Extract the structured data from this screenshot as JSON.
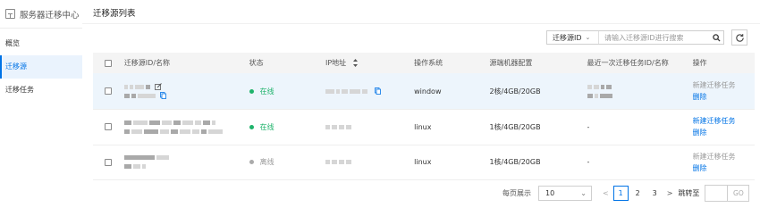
{
  "sidebar": {
    "title": "服务器迁移中心",
    "items": [
      {
        "label": "概览"
      },
      {
        "label": "迁移源"
      },
      {
        "label": "迁移任务"
      }
    ]
  },
  "page": {
    "title": "迁移源列表"
  },
  "search": {
    "field_label": "迁移源ID",
    "placeholder": "请输入迁移源ID进行搜索",
    "icon": "search-icon"
  },
  "refresh": {
    "icon": "refresh-icon"
  },
  "table": {
    "headers": [
      "迁移源ID/名称",
      "状态",
      "IP地址",
      "操作系统",
      "源端机器配置",
      "最近一次迁移任务ID/名称",
      "操作"
    ],
    "rows": [
      {
        "status": "在线",
        "os": "window",
        "config": "2核/4GB/20GB",
        "last_task": "",
        "op_primary": "新建迁移任务",
        "op_secondary": "删除"
      },
      {
        "status": "在线",
        "os": "linux",
        "config": "1核/4GB/20GB",
        "last_task": "-",
        "op_primary": "新建迁移任务",
        "op_secondary": "删除"
      },
      {
        "status": "离线",
        "os": "linux",
        "config": "1核/4GB/20GB",
        "last_task": "-",
        "op_primary": "新建迁移任务",
        "op_secondary": "删除"
      }
    ]
  },
  "pagination": {
    "page_size_label": "每页展示",
    "page_size": "10",
    "prev": "<",
    "pages": [
      "1",
      "2",
      "3"
    ],
    "next": ">",
    "jump_label": "跳转至",
    "go": "GO"
  },
  "colors": {
    "accent": "#0073e6",
    "online": "#1fb36b",
    "offline": "#aaaaaa"
  }
}
